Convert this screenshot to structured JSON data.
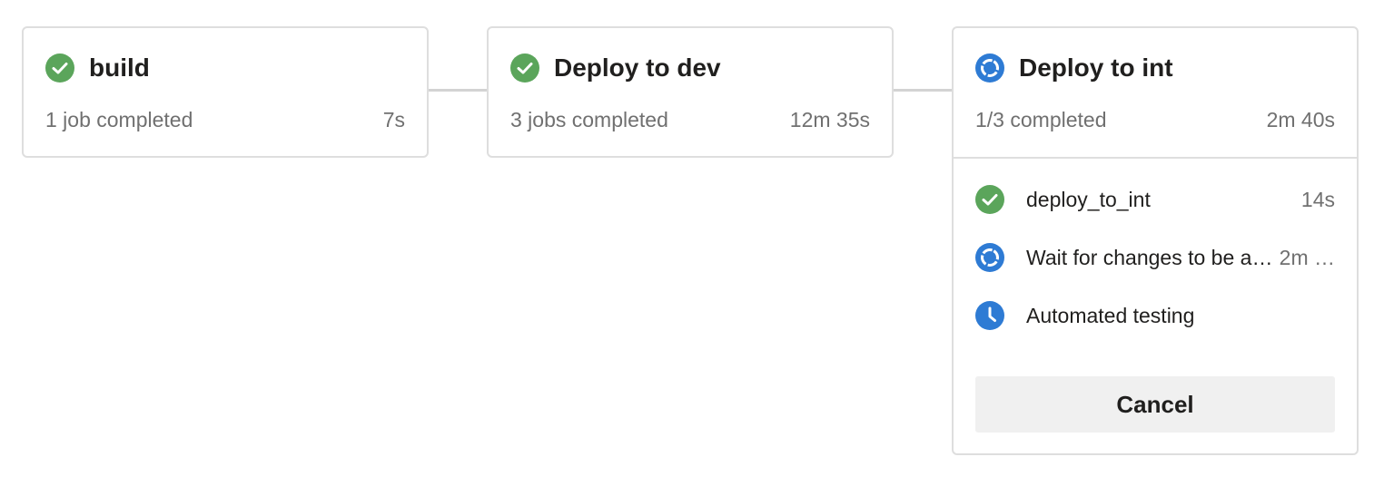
{
  "colors": {
    "success": "#5ba55b",
    "running": "#2e7bd4",
    "queued": "#2e7bd4"
  },
  "stages": [
    {
      "title": "build",
      "status_icon": "success-check-icon",
      "summary": "1 job completed",
      "duration": "7s"
    },
    {
      "title": "Deploy to dev",
      "status_icon": "success-check-icon",
      "summary": "3 jobs completed",
      "duration": "12m 35s"
    },
    {
      "title": "Deploy to int",
      "status_icon": "running-spinner-icon",
      "summary": "1/3 completed",
      "duration": "2m 40s",
      "jobs": [
        {
          "name": "deploy_to_int",
          "status_icon": "success-check-icon",
          "duration": "14s"
        },
        {
          "name": "Wait for changes to be approved",
          "status_icon": "running-spinner-icon",
          "duration": "2m …"
        },
        {
          "name": "Automated testing",
          "status_icon": "queued-clock-icon",
          "duration": ""
        }
      ],
      "cancel_label": "Cancel"
    }
  ]
}
